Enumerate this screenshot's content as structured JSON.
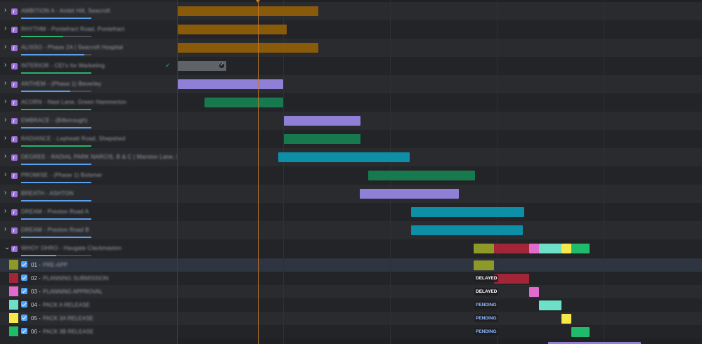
{
  "projects": [
    {
      "name": "AMBITION A - Ambit Hill, Seacroft",
      "bar_color": "#5aa0ef",
      "progress": 1.0,
      "checked": false
    },
    {
      "name": "RHYTHM - Pontefract Road, Pontefract",
      "bar_color": "#28b46a",
      "progress": 0.6,
      "checked": false
    },
    {
      "name": "ALISSO - Phase 2A | Seacroft Hospital",
      "bar_color": "#5aa0ef",
      "progress": 0.9,
      "checked": false
    },
    {
      "name": "INTERIOR - CEI's for Marketing",
      "bar_color": "#28b46a",
      "progress": 1.0,
      "checked": true
    },
    {
      "name": "ANTHEM - (Phase 1) Beverley",
      "bar_color": "#5aa0ef",
      "progress": 0.7,
      "checked": false
    },
    {
      "name": "ACORN - Nast Lane, Green Hammerton",
      "bar_color": "#28b46a",
      "progress": 1.0,
      "checked": false
    },
    {
      "name": "EMBRACE - (Bilborough)",
      "bar_color": "#5aa0ef",
      "progress": 1.0,
      "checked": false
    },
    {
      "name": "RADIANCE - Lepheatt Road, Shepshed",
      "bar_color": "#28b46a",
      "progress": 1.0,
      "checked": false
    },
    {
      "name": "DEGREE - RADIAL PARK NARCIS, B & C | Marston Lane, Co...",
      "bar_color": "#5aa0ef",
      "progress": 1.0,
      "checked": false
    },
    {
      "name": "PROMISE - (Phase 1) Bolsmer",
      "bar_color": "#5aa0ef",
      "progress": 1.0,
      "checked": false
    },
    {
      "name": "BREATH - ASHTON",
      "bar_color": "#5aa0ef",
      "progress": 1.0,
      "checked": false
    },
    {
      "name": "DREAM - Preston Road A",
      "bar_color": "#5aa0ef",
      "progress": 1.0,
      "checked": false
    },
    {
      "name": "DREAM - Preston Road B",
      "bar_color": "#5aa0ef",
      "progress": 1.0,
      "checked": false
    },
    {
      "name": "WHOY OHRO - Haugate Clackmaston",
      "bar_color": "#5aa0ef",
      "progress": 0.5,
      "checked": false
    }
  ],
  "tasks": [
    {
      "num": "01 -",
      "name": "PRE-APP",
      "color": "#8d9a28",
      "status": ""
    },
    {
      "num": "02 -",
      "name": "PLANNING SUBMISSION",
      "color": "#a32638",
      "status": "DELAYED"
    },
    {
      "num": "03 -",
      "name": "PLANNING APPROVAL",
      "color": "#e06bcc",
      "status": "DELAYED"
    },
    {
      "num": "04 -",
      "name": "PACK A RELEASE",
      "color": "#6ee0c8",
      "status": "PENDING"
    },
    {
      "num": "05 -",
      "name": "PACK 3A RELEASE",
      "color": "#f6e84a",
      "status": "PENDING"
    },
    {
      "num": "06 -",
      "name": "PACK 3B RELEASE",
      "color": "#1fbb6a",
      "status": "PENDING"
    }
  ],
  "status_colors": {
    "DELAYED": "#ffffff",
    "PENDING": "#8ab8ff"
  },
  "bar_colors": {
    "ochre": "#8a5a0b",
    "grey": "#5f6368",
    "lavender": "#8f7fd6",
    "green": "#167a4e",
    "teal": "#0e8fa8"
  },
  "today_marker_color": "#c97a28",
  "checkmark_icon": "check-icon",
  "expand_icon": "chevron-right-icon",
  "collapse_icon": "chevron-down-icon"
}
